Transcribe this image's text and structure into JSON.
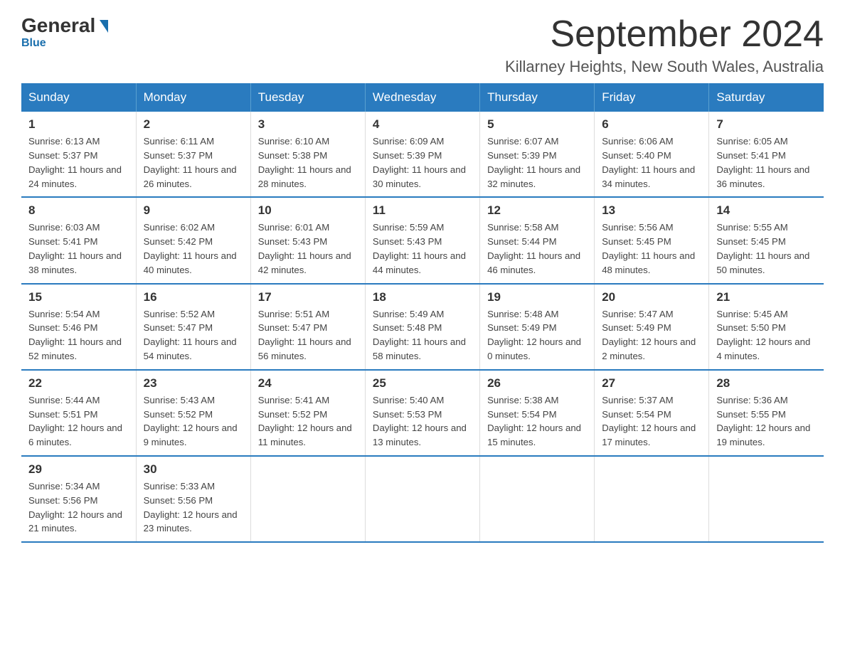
{
  "header": {
    "logo_general": "General",
    "logo_blue": "Blue",
    "month_title": "September 2024",
    "location": "Killarney Heights, New South Wales, Australia"
  },
  "days_of_week": [
    "Sunday",
    "Monday",
    "Tuesday",
    "Wednesday",
    "Thursday",
    "Friday",
    "Saturday"
  ],
  "weeks": [
    [
      {
        "day": "1",
        "sunrise": "6:13 AM",
        "sunset": "5:37 PM",
        "daylight": "11 hours and 24 minutes."
      },
      {
        "day": "2",
        "sunrise": "6:11 AM",
        "sunset": "5:37 PM",
        "daylight": "11 hours and 26 minutes."
      },
      {
        "day": "3",
        "sunrise": "6:10 AM",
        "sunset": "5:38 PM",
        "daylight": "11 hours and 28 minutes."
      },
      {
        "day": "4",
        "sunrise": "6:09 AM",
        "sunset": "5:39 PM",
        "daylight": "11 hours and 30 minutes."
      },
      {
        "day": "5",
        "sunrise": "6:07 AM",
        "sunset": "5:39 PM",
        "daylight": "11 hours and 32 minutes."
      },
      {
        "day": "6",
        "sunrise": "6:06 AM",
        "sunset": "5:40 PM",
        "daylight": "11 hours and 34 minutes."
      },
      {
        "day": "7",
        "sunrise": "6:05 AM",
        "sunset": "5:41 PM",
        "daylight": "11 hours and 36 minutes."
      }
    ],
    [
      {
        "day": "8",
        "sunrise": "6:03 AM",
        "sunset": "5:41 PM",
        "daylight": "11 hours and 38 minutes."
      },
      {
        "day": "9",
        "sunrise": "6:02 AM",
        "sunset": "5:42 PM",
        "daylight": "11 hours and 40 minutes."
      },
      {
        "day": "10",
        "sunrise": "6:01 AM",
        "sunset": "5:43 PM",
        "daylight": "11 hours and 42 minutes."
      },
      {
        "day": "11",
        "sunrise": "5:59 AM",
        "sunset": "5:43 PM",
        "daylight": "11 hours and 44 minutes."
      },
      {
        "day": "12",
        "sunrise": "5:58 AM",
        "sunset": "5:44 PM",
        "daylight": "11 hours and 46 minutes."
      },
      {
        "day": "13",
        "sunrise": "5:56 AM",
        "sunset": "5:45 PM",
        "daylight": "11 hours and 48 minutes."
      },
      {
        "day": "14",
        "sunrise": "5:55 AM",
        "sunset": "5:45 PM",
        "daylight": "11 hours and 50 minutes."
      }
    ],
    [
      {
        "day": "15",
        "sunrise": "5:54 AM",
        "sunset": "5:46 PM",
        "daylight": "11 hours and 52 minutes."
      },
      {
        "day": "16",
        "sunrise": "5:52 AM",
        "sunset": "5:47 PM",
        "daylight": "11 hours and 54 minutes."
      },
      {
        "day": "17",
        "sunrise": "5:51 AM",
        "sunset": "5:47 PM",
        "daylight": "11 hours and 56 minutes."
      },
      {
        "day": "18",
        "sunrise": "5:49 AM",
        "sunset": "5:48 PM",
        "daylight": "11 hours and 58 minutes."
      },
      {
        "day": "19",
        "sunrise": "5:48 AM",
        "sunset": "5:49 PM",
        "daylight": "12 hours and 0 minutes."
      },
      {
        "day": "20",
        "sunrise": "5:47 AM",
        "sunset": "5:49 PM",
        "daylight": "12 hours and 2 minutes."
      },
      {
        "day": "21",
        "sunrise": "5:45 AM",
        "sunset": "5:50 PM",
        "daylight": "12 hours and 4 minutes."
      }
    ],
    [
      {
        "day": "22",
        "sunrise": "5:44 AM",
        "sunset": "5:51 PM",
        "daylight": "12 hours and 6 minutes."
      },
      {
        "day": "23",
        "sunrise": "5:43 AM",
        "sunset": "5:52 PM",
        "daylight": "12 hours and 9 minutes."
      },
      {
        "day": "24",
        "sunrise": "5:41 AM",
        "sunset": "5:52 PM",
        "daylight": "12 hours and 11 minutes."
      },
      {
        "day": "25",
        "sunrise": "5:40 AM",
        "sunset": "5:53 PM",
        "daylight": "12 hours and 13 minutes."
      },
      {
        "day": "26",
        "sunrise": "5:38 AM",
        "sunset": "5:54 PM",
        "daylight": "12 hours and 15 minutes."
      },
      {
        "day": "27",
        "sunrise": "5:37 AM",
        "sunset": "5:54 PM",
        "daylight": "12 hours and 17 minutes."
      },
      {
        "day": "28",
        "sunrise": "5:36 AM",
        "sunset": "5:55 PM",
        "daylight": "12 hours and 19 minutes."
      }
    ],
    [
      {
        "day": "29",
        "sunrise": "5:34 AM",
        "sunset": "5:56 PM",
        "daylight": "12 hours and 21 minutes."
      },
      {
        "day": "30",
        "sunrise": "5:33 AM",
        "sunset": "5:56 PM",
        "daylight": "12 hours and 23 minutes."
      },
      null,
      null,
      null,
      null,
      null
    ]
  ],
  "labels": {
    "sunrise_prefix": "Sunrise: ",
    "sunset_prefix": "Sunset: ",
    "daylight_prefix": "Daylight: "
  }
}
